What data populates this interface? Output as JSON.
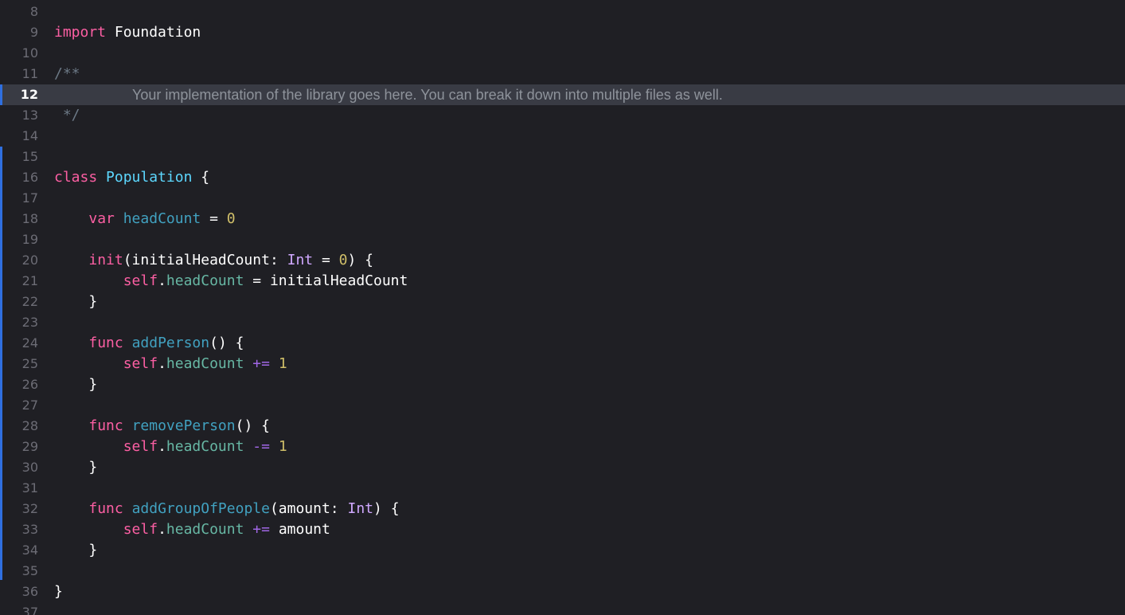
{
  "editor": {
    "language": "Swift",
    "current_line": "12",
    "colors": {
      "background": "#1f1f24",
      "current_line_highlight": "#393b44",
      "change_bar": "#2f6fe0",
      "keyword": "#fc5fa3",
      "type_declaration": "#5dd8ff",
      "property": "#41a1c0",
      "member": "#67b7a4",
      "number": "#d0bf69",
      "comment": "#6c7986"
    },
    "lines": [
      {
        "num": "8",
        "tokens": []
      },
      {
        "num": "9",
        "tokens": [
          {
            "t": "import",
            "c": "kw"
          },
          {
            "t": " Foundation",
            "c": "plain"
          }
        ]
      },
      {
        "num": "10",
        "tokens": []
      },
      {
        "num": "11",
        "tokens": [
          {
            "t": "/**",
            "c": "cmt"
          }
        ]
      },
      {
        "num": "12",
        "tokens": [
          {
            "t": "Your implementation of the library goes here. You can break it down into multiple files as well.",
            "c": "comment-text"
          }
        ]
      },
      {
        "num": "13",
        "tokens": [
          {
            "t": " */",
            "c": "cmt"
          }
        ]
      },
      {
        "num": "14",
        "tokens": []
      },
      {
        "num": "15",
        "tokens": []
      },
      {
        "num": "16",
        "tokens": [
          {
            "t": "class",
            "c": "kw"
          },
          {
            "t": " ",
            "c": "plain"
          },
          {
            "t": "Population",
            "c": "type-decl"
          },
          {
            "t": " {",
            "c": "plain"
          }
        ]
      },
      {
        "num": "17",
        "tokens": []
      },
      {
        "num": "18",
        "tokens": [
          {
            "t": "    ",
            "c": "plain"
          },
          {
            "t": "var",
            "c": "kw"
          },
          {
            "t": " ",
            "c": "plain"
          },
          {
            "t": "headCount",
            "c": "prop"
          },
          {
            "t": " = ",
            "c": "plain"
          },
          {
            "t": "0",
            "c": "num"
          }
        ]
      },
      {
        "num": "19",
        "tokens": []
      },
      {
        "num": "20",
        "tokens": [
          {
            "t": "    ",
            "c": "plain"
          },
          {
            "t": "init",
            "c": "kw"
          },
          {
            "t": "(initialHeadCount: ",
            "c": "plain"
          },
          {
            "t": "Int",
            "c": "builtin-type"
          },
          {
            "t": " = ",
            "c": "plain"
          },
          {
            "t": "0",
            "c": "num"
          },
          {
            "t": ") {",
            "c": "plain"
          }
        ]
      },
      {
        "num": "21",
        "tokens": [
          {
            "t": "        ",
            "c": "plain"
          },
          {
            "t": "self",
            "c": "kw"
          },
          {
            "t": ".",
            "c": "plain"
          },
          {
            "t": "headCount",
            "c": "member"
          },
          {
            "t": " = initialHeadCount",
            "c": "plain"
          }
        ]
      },
      {
        "num": "22",
        "tokens": [
          {
            "t": "    }",
            "c": "plain"
          }
        ]
      },
      {
        "num": "23",
        "tokens": []
      },
      {
        "num": "24",
        "tokens": [
          {
            "t": "    ",
            "c": "plain"
          },
          {
            "t": "func",
            "c": "kw"
          },
          {
            "t": " ",
            "c": "plain"
          },
          {
            "t": "addPerson",
            "c": "prop"
          },
          {
            "t": "() {",
            "c": "plain"
          }
        ]
      },
      {
        "num": "25",
        "tokens": [
          {
            "t": "        ",
            "c": "plain"
          },
          {
            "t": "self",
            "c": "kw"
          },
          {
            "t": ".",
            "c": "plain"
          },
          {
            "t": "headCount",
            "c": "member"
          },
          {
            "t": " ",
            "c": "plain"
          },
          {
            "t": "+=",
            "c": "op"
          },
          {
            "t": " ",
            "c": "plain"
          },
          {
            "t": "1",
            "c": "num"
          }
        ]
      },
      {
        "num": "26",
        "tokens": [
          {
            "t": "    }",
            "c": "plain"
          }
        ]
      },
      {
        "num": "27",
        "tokens": []
      },
      {
        "num": "28",
        "tokens": [
          {
            "t": "    ",
            "c": "plain"
          },
          {
            "t": "func",
            "c": "kw"
          },
          {
            "t": " ",
            "c": "plain"
          },
          {
            "t": "removePerson",
            "c": "prop"
          },
          {
            "t": "() {",
            "c": "plain"
          }
        ]
      },
      {
        "num": "29",
        "tokens": [
          {
            "t": "        ",
            "c": "plain"
          },
          {
            "t": "self",
            "c": "kw"
          },
          {
            "t": ".",
            "c": "plain"
          },
          {
            "t": "headCount",
            "c": "member"
          },
          {
            "t": " ",
            "c": "plain"
          },
          {
            "t": "-=",
            "c": "op"
          },
          {
            "t": " ",
            "c": "plain"
          },
          {
            "t": "1",
            "c": "num"
          }
        ]
      },
      {
        "num": "30",
        "tokens": [
          {
            "t": "    }",
            "c": "plain"
          }
        ]
      },
      {
        "num": "31",
        "tokens": []
      },
      {
        "num": "32",
        "tokens": [
          {
            "t": "    ",
            "c": "plain"
          },
          {
            "t": "func",
            "c": "kw"
          },
          {
            "t": " ",
            "c": "plain"
          },
          {
            "t": "addGroupOfPeople",
            "c": "prop"
          },
          {
            "t": "(amount: ",
            "c": "plain"
          },
          {
            "t": "Int",
            "c": "builtin-type"
          },
          {
            "t": ") {",
            "c": "plain"
          }
        ]
      },
      {
        "num": "33",
        "tokens": [
          {
            "t": "        ",
            "c": "plain"
          },
          {
            "t": "self",
            "c": "kw"
          },
          {
            "t": ".",
            "c": "plain"
          },
          {
            "t": "headCount",
            "c": "member"
          },
          {
            "t": " ",
            "c": "plain"
          },
          {
            "t": "+=",
            "c": "op"
          },
          {
            "t": " amount",
            "c": "plain"
          }
        ]
      },
      {
        "num": "34",
        "tokens": [
          {
            "t": "    }",
            "c": "plain"
          }
        ]
      },
      {
        "num": "35",
        "tokens": []
      },
      {
        "num": "36",
        "tokens": [
          {
            "t": "}",
            "c": "plain"
          }
        ]
      },
      {
        "num": "37",
        "tokens": []
      }
    ]
  }
}
